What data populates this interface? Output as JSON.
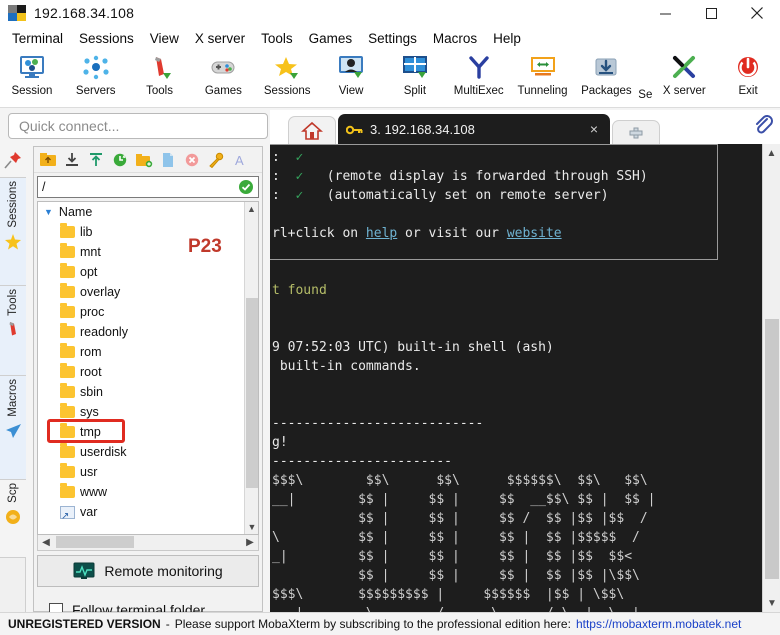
{
  "window": {
    "title": "192.168.34.108",
    "minimize": "minimize-button",
    "maximize": "maximize-button",
    "close": "close-button"
  },
  "menu": {
    "items": [
      {
        "label": "Terminal"
      },
      {
        "label": "Sessions"
      },
      {
        "label": "View"
      },
      {
        "label": "X server"
      },
      {
        "label": "Tools"
      },
      {
        "label": "Games"
      },
      {
        "label": "Settings"
      },
      {
        "label": "Macros"
      },
      {
        "label": "Help"
      }
    ]
  },
  "toolbar": {
    "items": [
      {
        "label": "Session",
        "icon": "session-icon"
      },
      {
        "label": "Servers",
        "icon": "servers-icon"
      },
      {
        "label": "Tools",
        "icon": "tools-icon"
      },
      {
        "label": "Games",
        "icon": "games-icon"
      },
      {
        "label": "Sessions",
        "icon": "sessions-star-icon"
      },
      {
        "label": "View",
        "icon": "view-icon"
      },
      {
        "label": "Split",
        "icon": "split-icon"
      },
      {
        "label": "MultiExec",
        "icon": "multiexec-icon"
      },
      {
        "label": "Tunneling",
        "icon": "tunneling-icon"
      },
      {
        "label": "Packages",
        "icon": "packages-icon"
      },
      {
        "label": "X server",
        "icon": "xserver-icon"
      },
      {
        "label": "Exit",
        "icon": "exit-icon"
      }
    ],
    "truncated_label": "Se"
  },
  "quick_connect": {
    "placeholder": "Quick connect..."
  },
  "side_tabs": {
    "items": [
      {
        "label": "Sessions",
        "icon": "star-icon"
      },
      {
        "label": "Tools",
        "icon": "wrench-icon"
      },
      {
        "label": "Macros",
        "icon": "paper-plane-icon"
      },
      {
        "label": "Scp",
        "icon": "scp-icon"
      }
    ],
    "pin": "pin-icon"
  },
  "file_browser": {
    "toolbar": [
      {
        "name": "parent-folder-icon"
      },
      {
        "name": "download-icon"
      },
      {
        "name": "upload-icon"
      },
      {
        "name": "refresh-icon"
      },
      {
        "name": "new-folder-icon"
      },
      {
        "name": "new-file-icon"
      },
      {
        "name": "delete-icon"
      },
      {
        "name": "permissions-icon"
      },
      {
        "name": "text-mode-icon"
      }
    ],
    "path": "/",
    "path_ok": "ok-icon",
    "column_header": "Name",
    "rows": [
      {
        "name": "lib",
        "type": "folder"
      },
      {
        "name": "mnt",
        "type": "folder"
      },
      {
        "name": "opt",
        "type": "folder"
      },
      {
        "name": "overlay",
        "type": "folder"
      },
      {
        "name": "proc",
        "type": "folder"
      },
      {
        "name": "readonly",
        "type": "folder"
      },
      {
        "name": "rom",
        "type": "folder"
      },
      {
        "name": "root",
        "type": "folder"
      },
      {
        "name": "sbin",
        "type": "folder"
      },
      {
        "name": "sys",
        "type": "folder"
      },
      {
        "name": "tmp",
        "type": "folder",
        "highlighted": true
      },
      {
        "name": "userdisk",
        "type": "folder"
      },
      {
        "name": "usr",
        "type": "folder"
      },
      {
        "name": "www",
        "type": "folder"
      },
      {
        "name": "var",
        "type": "shortcut"
      }
    ],
    "remote_monitoring": "Remote monitoring",
    "follow_terminal_folder": "Follow terminal folder",
    "annotation": "P23",
    "annotation_color": "#c0392b",
    "highlight_color": "#e02b20"
  },
  "tabs": {
    "home": "home-icon",
    "session": {
      "icon": "key-icon",
      "label": "3. 192.168.34.108",
      "close": "×"
    },
    "new_tab": "+",
    "attach": "paperclip-icon"
  },
  "terminal": {
    "lines": [
      {
        "segments": [
          {
            "t": ":",
            "c": "white"
          },
          {
            "t": "  ",
            "c": "white"
          },
          {
            "t": "✓",
            "c": "green"
          }
        ]
      },
      {
        "segments": [
          {
            "t": ":",
            "c": "white"
          },
          {
            "t": "  ",
            "c": "white"
          },
          {
            "t": "✓",
            "c": "green"
          },
          {
            "t": "   (remote display is forwarded through SSH)",
            "c": "white"
          }
        ]
      },
      {
        "segments": [
          {
            "t": ":",
            "c": "white"
          },
          {
            "t": "  ",
            "c": "white"
          },
          {
            "t": "✓",
            "c": "green"
          },
          {
            "t": "   (automatically set on remote server)",
            "c": "white"
          }
        ]
      },
      {
        "segments": [
          {
            "t": "",
            "c": "white"
          }
        ]
      },
      {
        "segments": [
          {
            "t": "rl+click on ",
            "c": "white"
          },
          {
            "t": "help",
            "c": "link"
          },
          {
            "t": " or visit our ",
            "c": "white"
          },
          {
            "t": "website",
            "c": "link"
          }
        ]
      },
      {
        "segments": [
          {
            "t": "",
            "c": "white"
          }
        ]
      },
      {
        "segments": [
          {
            "t": "",
            "c": "white"
          }
        ]
      },
      {
        "segments": [
          {
            "t": "t found",
            "c": "yellow"
          }
        ]
      },
      {
        "segments": [
          {
            "t": "",
            "c": "white"
          }
        ]
      },
      {
        "segments": [
          {
            "t": "",
            "c": "white"
          }
        ]
      },
      {
        "segments": [
          {
            "t": "9 07:52:03 UTC) built-in shell (ash)",
            "c": "white"
          }
        ]
      },
      {
        "segments": [
          {
            "t": " built-in commands.",
            "c": "white"
          }
        ]
      },
      {
        "segments": [
          {
            "t": "",
            "c": "white"
          }
        ]
      },
      {
        "segments": [
          {
            "t": "",
            "c": "white"
          }
        ]
      },
      {
        "segments": [
          {
            "t": "---------------------------",
            "c": "white"
          }
        ]
      },
      {
        "segments": [
          {
            "t": "g!",
            "c": "white"
          }
        ]
      },
      {
        "segments": [
          {
            "t": "-----------------------",
            "c": "white"
          }
        ]
      },
      {
        "segments": [
          {
            "t": "$$$\\        $$\\      $$\\      $$$$$$\\  $$\\   $$\\",
            "c": "grey"
          }
        ]
      },
      {
        "segments": [
          {
            "t": "__|        $$ |     $$ |     $$  __$$\\ $$ |  $$ |",
            "c": "grey"
          }
        ]
      },
      {
        "segments": [
          {
            "t": "           $$ |     $$ |     $$ /  $$ |$$ |$$  /",
            "c": "grey"
          }
        ]
      },
      {
        "segments": [
          {
            "t": "\\          $$ |     $$ |     $$ |  $$ |$$$$$  /",
            "c": "grey"
          }
        ]
      },
      {
        "segments": [
          {
            "t": "_|         $$ |     $$ |     $$ |  $$ |$$  $$<",
            "c": "grey"
          }
        ]
      },
      {
        "segments": [
          {
            "t": "           $$ |     $$ |     $$ |  $$ |$$ |\\$$\\",
            "c": "grey"
          }
        ]
      },
      {
        "segments": [
          {
            "t": "$$$\\       $$$$$$$$$ |     $$$$$$  |$$ | \\$$\\",
            "c": "grey"
          }
        ]
      },
      {
        "segments": [
          {
            "t": "___|        \\________/      \\______/ \\__|  \\__|",
            "c": "grey"
          }
        ]
      }
    ]
  },
  "status_bar": {
    "bold": "UNREGISTERED VERSION",
    "dash": "-",
    "text": "Please support MobaXterm by subscribing to the professional edition here:",
    "link": "https://mobaxterm.mobatek.net",
    "link_color": "#1a41c8"
  }
}
